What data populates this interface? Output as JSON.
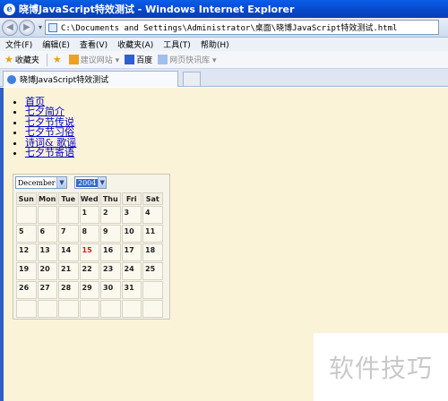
{
  "window": {
    "title": "晓博JavaScript特效测试 - Windows Internet Explorer"
  },
  "address": {
    "url": "C:\\Documents and Settings\\Administrator\\桌面\\晓博JavaScript特效测试.html"
  },
  "menu": {
    "items": [
      "文件(F)",
      "编辑(E)",
      "查看(V)",
      "收藏夹(A)",
      "工具(T)",
      "帮助(H)"
    ]
  },
  "favorites": {
    "label": "收藏夹",
    "suggested": "建议网站 ▾",
    "baidu": "百度",
    "webslice": "网页快讯库 ▾"
  },
  "tab": {
    "title": "晓博JavaScript特效测试"
  },
  "nav_links": [
    "首页",
    "七夕简介",
    "七夕节传说",
    "七夕节习俗",
    "诗词& 歌谣",
    "七夕节寄语"
  ],
  "calendar": {
    "month": "December",
    "year": "2004",
    "weekdays": [
      "Sun",
      "Mon",
      "Tue",
      "Wed",
      "Thu",
      "Fri",
      "Sat"
    ],
    "weeks": [
      [
        "",
        "",
        "",
        "1",
        "2",
        "3",
        "4"
      ],
      [
        "5",
        "6",
        "7",
        "8",
        "9",
        "10",
        "11"
      ],
      [
        "12",
        "13",
        "14",
        "15",
        "16",
        "17",
        "18"
      ],
      [
        "19",
        "20",
        "21",
        "22",
        "23",
        "24",
        "25"
      ],
      [
        "26",
        "27",
        "28",
        "29",
        "30",
        "31",
        ""
      ],
      [
        "",
        "",
        "",
        "",
        "",
        "",
        ""
      ]
    ],
    "highlighted_day": "15",
    "highlight_color": "#d11c1c"
  },
  "watermark": "软件技巧"
}
